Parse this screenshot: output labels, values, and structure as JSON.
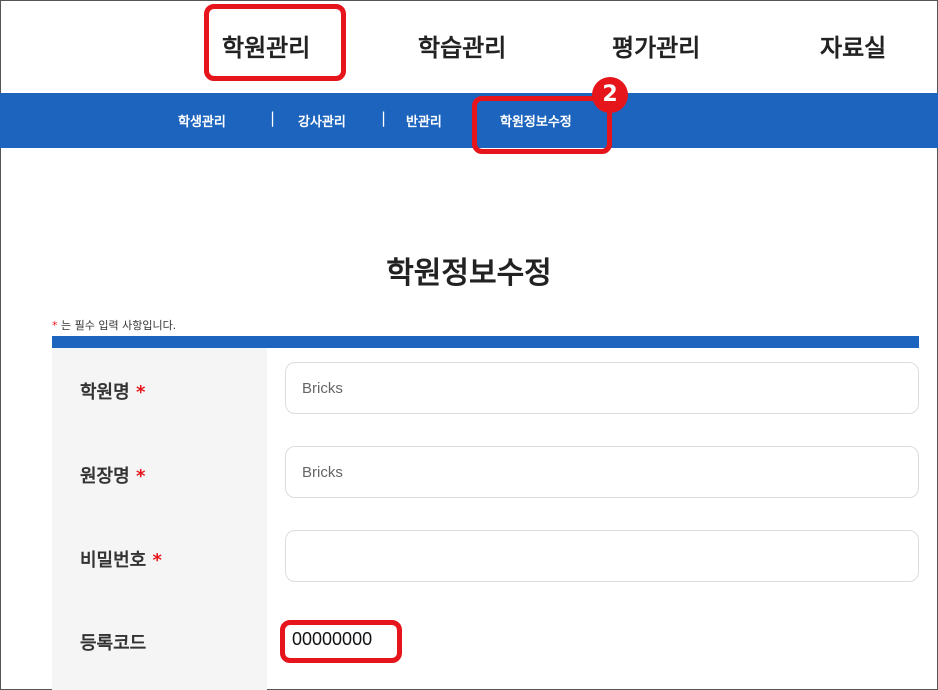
{
  "topnav": {
    "items": [
      "학원관리",
      "학습관리",
      "평가관리",
      "자료실"
    ]
  },
  "subnav": {
    "items": [
      "학생관리",
      "강사관리",
      "반관리",
      "학원정보수정"
    ],
    "separator": "|"
  },
  "badge": "2",
  "page_title": "학원정보수정",
  "required_note": {
    "star": "*",
    "text": " 는 필수 입력 사항입니다."
  },
  "form": {
    "academy_name": {
      "label": "학원명",
      "required_mark": "*",
      "value": "Bricks"
    },
    "director_name": {
      "label": "원장명",
      "required_mark": "*",
      "value": "Bricks"
    },
    "password": {
      "label": "비밀번호",
      "required_mark": "*",
      "value": ""
    },
    "registration_code": {
      "label": "등록코드",
      "value": "00000000"
    }
  },
  "colors": {
    "highlight": "#e5151b",
    "brand_blue": "#1c64bd"
  }
}
